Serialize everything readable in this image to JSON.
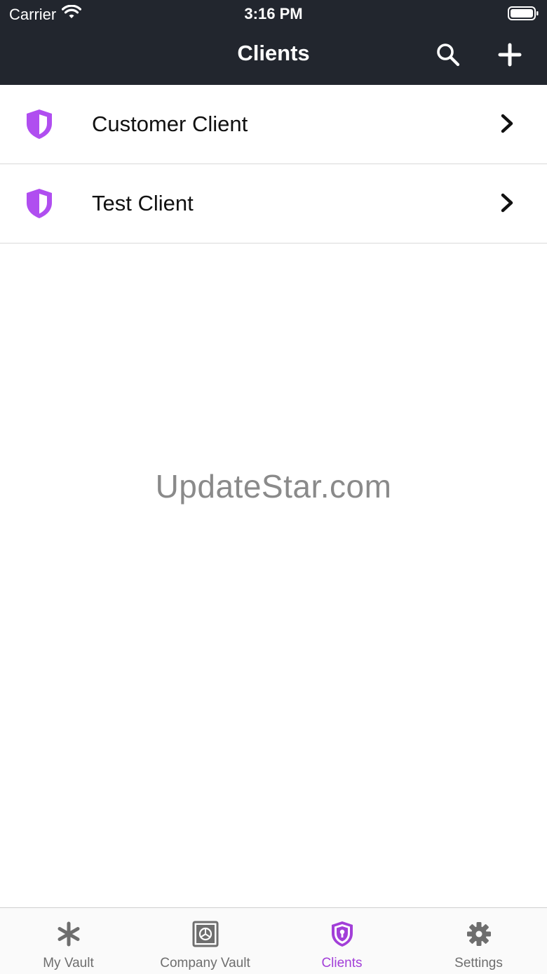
{
  "status": {
    "carrier": "Carrier",
    "time": "3:16 PM"
  },
  "nav": {
    "title": "Clients",
    "search_icon": "search-icon",
    "add_icon": "plus-icon"
  },
  "clients": [
    {
      "name": "Customer Client",
      "icon": "shield-icon"
    },
    {
      "name": "Test Client",
      "icon": "shield-icon"
    }
  ],
  "watermark": "UpdateStar.com",
  "tabs": [
    {
      "label": "My Vault",
      "icon": "asterisk-icon",
      "active": false
    },
    {
      "label": "Company Vault",
      "icon": "safe-icon",
      "active": false
    },
    {
      "label": "Clients",
      "icon": "shield-keyhole-icon",
      "active": true
    },
    {
      "label": "Settings",
      "icon": "gear-icon",
      "active": false
    }
  ],
  "colors": {
    "header_bg": "#22262e",
    "accent_purple": "#a23fd8",
    "shield_purple": "#b04ef0",
    "tab_inactive": "#6e6e6e"
  }
}
